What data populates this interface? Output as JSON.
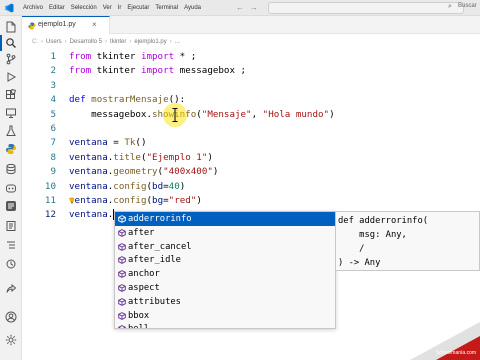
{
  "menu": [
    "Archivo",
    "Editar",
    "Selección",
    "Ver",
    "Ir",
    "Ejecutar",
    "Terminal",
    "Ayuda"
  ],
  "search": {
    "label": "Buscar"
  },
  "tab": {
    "label": "ejemplo1.py",
    "close": "×"
  },
  "breadcrumb": [
    "Users",
    "Desarrollo 5",
    "tkinter",
    "ejemplo1.py",
    "..."
  ],
  "code_lines": [
    {
      "num": "1",
      "segments": [
        {
          "t": "from",
          "c": "kw2"
        },
        {
          "t": " tkinter ",
          "c": ""
        },
        {
          "t": "import",
          "c": "kw2"
        },
        {
          "t": " * ;",
          "c": ""
        }
      ]
    },
    {
      "num": "2",
      "segments": [
        {
          "t": "from",
          "c": "kw2"
        },
        {
          "t": " tkinter ",
          "c": ""
        },
        {
          "t": "import",
          "c": "kw2"
        },
        {
          "t": " messagebox ;",
          "c": ""
        }
      ]
    },
    {
      "num": "3",
      "segments": []
    },
    {
      "num": "4",
      "segments": [
        {
          "t": "def",
          "c": "kw"
        },
        {
          "t": " ",
          "c": ""
        },
        {
          "t": "mostrarMensaje",
          "c": "fn"
        },
        {
          "t": "():",
          "c": ""
        }
      ]
    },
    {
      "num": "5",
      "segments": [
        {
          "t": "    messagebox.",
          "c": ""
        },
        {
          "t": "showinfo",
          "c": "fn"
        },
        {
          "t": "(",
          "c": ""
        },
        {
          "t": "\"Mensaje\"",
          "c": "str"
        },
        {
          "t": ", ",
          "c": ""
        },
        {
          "t": "\"Hola mundo\"",
          "c": "str"
        },
        {
          "t": ")",
          "c": ""
        }
      ]
    },
    {
      "num": "6",
      "segments": []
    },
    {
      "num": "7",
      "segments": [
        {
          "t": "ventana",
          "c": "var"
        },
        {
          "t": " = ",
          "c": ""
        },
        {
          "t": "Tk",
          "c": "fn"
        },
        {
          "t": "()",
          "c": ""
        }
      ]
    },
    {
      "num": "8",
      "segments": [
        {
          "t": "ventana",
          "c": "var"
        },
        {
          "t": ".",
          "c": ""
        },
        {
          "t": "title",
          "c": "fn"
        },
        {
          "t": "(",
          "c": ""
        },
        {
          "t": "\"Ejemplo 1\"",
          "c": "str"
        },
        {
          "t": ")",
          "c": ""
        }
      ]
    },
    {
      "num": "9",
      "segments": [
        {
          "t": "ventana",
          "c": "var"
        },
        {
          "t": ".",
          "c": ""
        },
        {
          "t": "geometry",
          "c": "fn"
        },
        {
          "t": "(",
          "c": ""
        },
        {
          "t": "\"400x400\"",
          "c": "str"
        },
        {
          "t": ")",
          "c": ""
        }
      ]
    },
    {
      "num": "10",
      "segments": [
        {
          "t": "ventana",
          "c": "var"
        },
        {
          "t": ".",
          "c": ""
        },
        {
          "t": "config",
          "c": "fn"
        },
        {
          "t": "(",
          "c": ""
        },
        {
          "t": "bd",
          "c": "var"
        },
        {
          "t": "=",
          "c": ""
        },
        {
          "t": "40",
          "c": "num"
        },
        {
          "t": ")",
          "c": ""
        }
      ]
    },
    {
      "num": "11",
      "segments": [
        {
          "t": "ventana",
          "c": "var"
        },
        {
          "t": ".",
          "c": ""
        },
        {
          "t": "config",
          "c": "fn"
        },
        {
          "t": "(",
          "c": ""
        },
        {
          "t": "bg",
          "c": "var"
        },
        {
          "t": "=",
          "c": ""
        },
        {
          "t": "\"red\"",
          "c": "str"
        },
        {
          "t": ")",
          "c": ""
        }
      ]
    },
    {
      "num": "12",
      "segments": [
        {
          "t": "ventana",
          "c": "var"
        },
        {
          "t": ".",
          "c": ""
        }
      ]
    }
  ],
  "suggestions": [
    "adderrorinfo",
    "after",
    "after_cancel",
    "after_idle",
    "anchor",
    "aspect",
    "attributes",
    "bbox",
    "bell"
  ],
  "suggestion_detail": [
    "def adderrorinfo(",
    "    msg: Any,",
    "    /",
    ") -> Any"
  ],
  "watermark": {
    "label": "Schoolmanía.com"
  },
  "colors": {
    "accent": "#005fb8",
    "selection": "#0060c0",
    "line_number": "#237893",
    "keyword": "#af00db",
    "function": "#795e26",
    "string": "#a31515",
    "number": "#098658",
    "variable": "#001080"
  }
}
